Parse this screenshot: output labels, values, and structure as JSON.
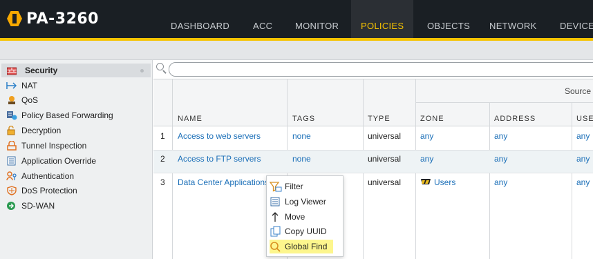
{
  "app": {
    "title": "PA-3260",
    "brand_color": "#f6a800",
    "accent_color": "#f6c300",
    "nav_tabs": [
      {
        "label": "DASHBOARD",
        "active": false
      },
      {
        "label": "ACC",
        "active": false
      },
      {
        "label": "MONITOR",
        "active": false
      },
      {
        "label": "POLICIES",
        "active": true
      },
      {
        "label": "OBJECTS",
        "active": false
      },
      {
        "label": "NETWORK",
        "active": false
      },
      {
        "label": "DEVICE",
        "active": false
      }
    ]
  },
  "sidebar": {
    "items": [
      {
        "label": "Security",
        "icon": "security-policy-icon",
        "active": true
      },
      {
        "label": "NAT",
        "icon": "nat-icon"
      },
      {
        "label": "QoS",
        "icon": "qos-icon"
      },
      {
        "label": "Policy Based Forwarding",
        "icon": "pbf-icon"
      },
      {
        "label": "Decryption",
        "icon": "decryption-icon"
      },
      {
        "label": "Tunnel Inspection",
        "icon": "tunnel-inspection-icon"
      },
      {
        "label": "Application Override",
        "icon": "application-override-icon"
      },
      {
        "label": "Authentication",
        "icon": "authentication-icon"
      },
      {
        "label": "DoS Protection",
        "icon": "dos-protection-icon"
      },
      {
        "label": "SD-WAN",
        "icon": "sd-wan-icon"
      }
    ]
  },
  "search": {
    "value": "",
    "placeholder": ""
  },
  "table": {
    "group_header": "Source",
    "columns": [
      "NAME",
      "TAGS",
      "TYPE",
      "ZONE",
      "ADDRESS",
      "USER"
    ],
    "rows": [
      {
        "num": "1",
        "name": "Access to web servers",
        "tags": "none",
        "type": "universal",
        "zone": "any",
        "address": "any",
        "user": "any"
      },
      {
        "num": "2",
        "name": "Access to FTP servers",
        "tags": "none",
        "type": "universal",
        "zone": "any",
        "address": "any",
        "user": "any"
      },
      {
        "num": "3",
        "name": "Data Center Applications",
        "tags": "",
        "type": "universal",
        "zone": "Users",
        "address": "any",
        "user": "any"
      }
    ]
  },
  "context_menu": {
    "items": [
      {
        "label": "Filter",
        "icon": "filter-icon"
      },
      {
        "label": "Log Viewer",
        "icon": "log-viewer-icon"
      },
      {
        "label": "Move",
        "icon": "move-arrow-icon"
      },
      {
        "label": "Copy UUID",
        "icon": "copy-icon"
      },
      {
        "label": "Global Find",
        "icon": "search-icon",
        "highlighted": true
      }
    ],
    "highlight_color": "#fdf68d"
  }
}
